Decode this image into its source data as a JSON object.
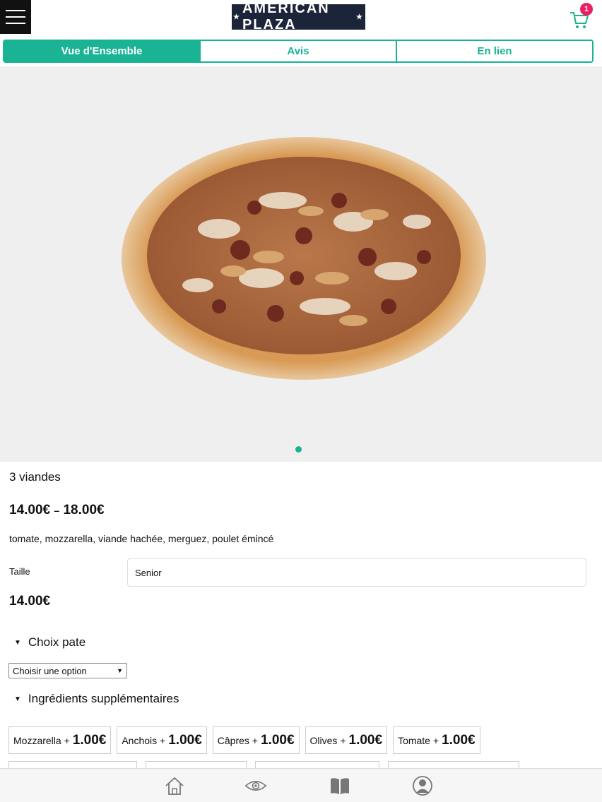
{
  "header": {
    "logo_text": "AMERICAN PLAZA",
    "cart_count": "1",
    "icons": [
      "menu-icon",
      "cart-icon"
    ]
  },
  "tabs": [
    {
      "label": "Vue d'Ensemble",
      "active": true
    },
    {
      "label": "Avis",
      "active": false
    },
    {
      "label": "En lien",
      "active": false
    }
  ],
  "product": {
    "name": "3 viandes",
    "price_range_min": "14.00€",
    "price_range_sep": "–",
    "price_range_max": "18.00€",
    "description": "tomate, mozzarella, viande hachée, merguez, poulet émincé",
    "size_label": "Taille",
    "size_value": "Senior",
    "current_price": "14.00€"
  },
  "options": {
    "pate_title": "Choix pate",
    "pate_select": "Choisir une option",
    "extras_title": "Ingrédients supplémentaires",
    "extras": [
      {
        "name": "Mozzarella",
        "plus": "+",
        "price": "1.00€"
      },
      {
        "name": "Anchois",
        "plus": "+",
        "price": "1.00€"
      },
      {
        "name": "Câpres",
        "plus": "+",
        "price": "1.00€"
      },
      {
        "name": "Olives",
        "plus": "+",
        "price": "1.00€"
      },
      {
        "name": "Tomate",
        "plus": "+",
        "price": "1.00€"
      }
    ]
  },
  "bottom_nav": [
    "home-icon",
    "eye-icon",
    "book-icon",
    "user-icon"
  ],
  "colors": {
    "accent": "#1ab394",
    "logo_bg": "#1b2438",
    "badge": "#e91e63"
  }
}
